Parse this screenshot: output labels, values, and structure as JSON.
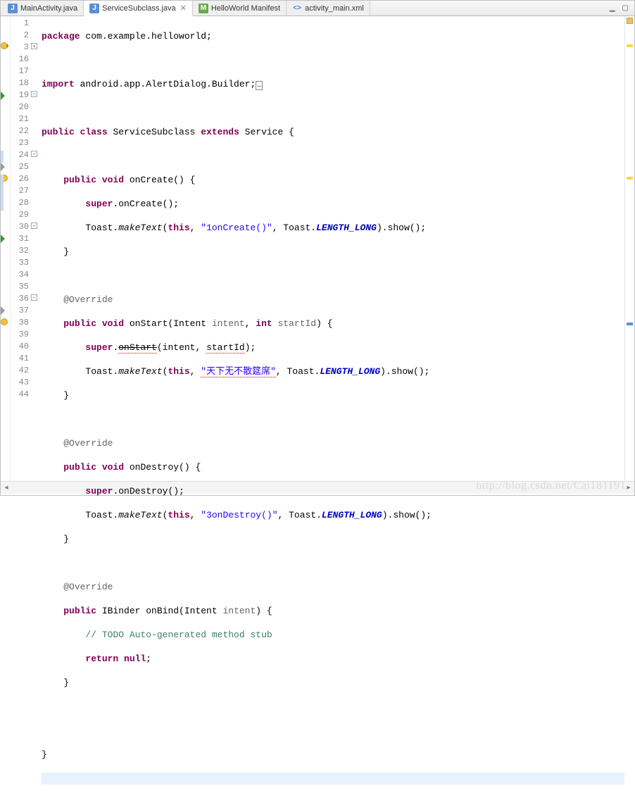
{
  "tabs": [
    {
      "label": "MainActivity.java",
      "icon": "J"
    },
    {
      "label": "ServiceSubclass.java",
      "icon": "J",
      "active": true,
      "closable": true
    },
    {
      "label": "HelloWorld Manifest",
      "icon": "M"
    },
    {
      "label": "activity_main.xml",
      "icon": "<>"
    }
  ],
  "window": {
    "minimize": "▁",
    "maximize": "▢"
  },
  "lines": [
    "1",
    "2",
    "3",
    "16",
    "17",
    "18",
    "19",
    "20",
    "21",
    "22",
    "23",
    "24",
    "25",
    "26",
    "27",
    "28",
    "29",
    "30",
    "31",
    "32",
    "33",
    "34",
    "35",
    "36",
    "37",
    "38",
    "39",
    "40",
    "41",
    "42",
    "43",
    "44"
  ],
  "code": {
    "pkg_kw": "package",
    "pkg_name": " com.example.helloworld;",
    "imp_kw": "import",
    "imp_name": " android.app.AlertDialog.Builder;",
    "cls_decl_1": "public",
    "cls_decl_2": "class",
    "cls_name": " ServiceSubclass ",
    "cls_decl_3": "extends",
    "cls_super": " Service {",
    "m1_sig": "public void",
    "m1_name": " onCreate() {",
    "m1_b1a": "super",
    "m1_b1b": ".onCreate();",
    "m1_b2a": "        Toast.",
    "m1_b2m": "makeText",
    "m1_b2b": "(",
    "m1_b2c": "this",
    "m1_b2d": ", ",
    "m1_str": "\"1onCreate()\"",
    "m1_b2e": ", Toast.",
    "m1_len": "LENGTH_LONG",
    "m1_b2f": ").show();",
    "close_brace": "    }",
    "override": "@Override",
    "m2_sig1": "public void",
    "m2_name": " onStart(Intent ",
    "m2_p1": "intent",
    "m2_mid": ", ",
    "m2_sig2": "int",
    "m2_p2": " startId",
    "m2_end": ") {",
    "m2_b1a": "super",
    "m2_b1b": ".",
    "m2_onstart": "onStart",
    "m2_b1c": "(intent, ",
    "m2_sid": "startId",
    "m2_b1d": ");",
    "m2_str": "\"天下无不散筵席\"",
    "m3_name": " onDestroy() {",
    "m3_b1b": ".onDestroy();",
    "m3_str": "\"3onDestroy()\"",
    "m4_sig": "public",
    "m4_ret": " IBinder onBind(Intent ",
    "m4_p": "intent",
    "m4_end": ") {",
    "m4_cmt": "// TODO Auto-generated method stub",
    "m4_ret_kw": "return",
    "m4_null": "null",
    "m4_semi": ";",
    "final_brace": "}"
  },
  "watermark": "http://blog.csdn.net/Cai181191"
}
